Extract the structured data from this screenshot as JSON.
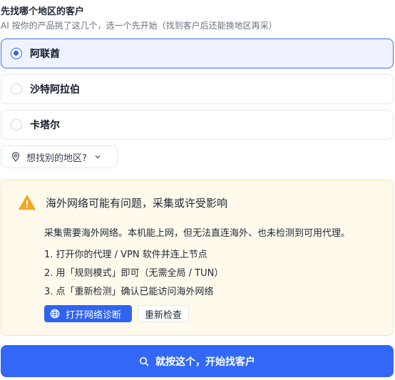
{
  "header": {
    "title": "先找哪个地区的客户",
    "subtitle": "AI 按你的产品挑了这几个，选一个先开始（找到客户后还能换地区再采）"
  },
  "regions": [
    {
      "label": "阿联酋",
      "selected": true
    },
    {
      "label": "沙特阿拉伯",
      "selected": false
    },
    {
      "label": "卡塔尔",
      "selected": false
    }
  ],
  "other_region": {
    "label": "想找别的地区?",
    "icon": "map-pin-icon",
    "chevron": "chevron-down-icon"
  },
  "warning": {
    "icon": "warning-triangle-icon",
    "title": "海外网络可能有问题，采集或许受影响",
    "description": "采集需要海外网络。本机能上网，但无法直连海外、也未检测到可用代理。",
    "steps": [
      "1. 打开你的代理 / VPN 软件并连上节点",
      "2. 用「规则模式」即可（无需全局 / TUN）",
      "3. 点「重新检测」确认已能访问海外网络"
    ],
    "diagnose_label": "打开网络诊断",
    "recheck_label": "重新检查"
  },
  "start_button": {
    "label": "就按这个，开始找客户",
    "icon": "search-icon"
  },
  "colors": {
    "accent": "#2f63f2",
    "warning_bg": "#fffaeb",
    "warning_icon": "#f5a623"
  }
}
